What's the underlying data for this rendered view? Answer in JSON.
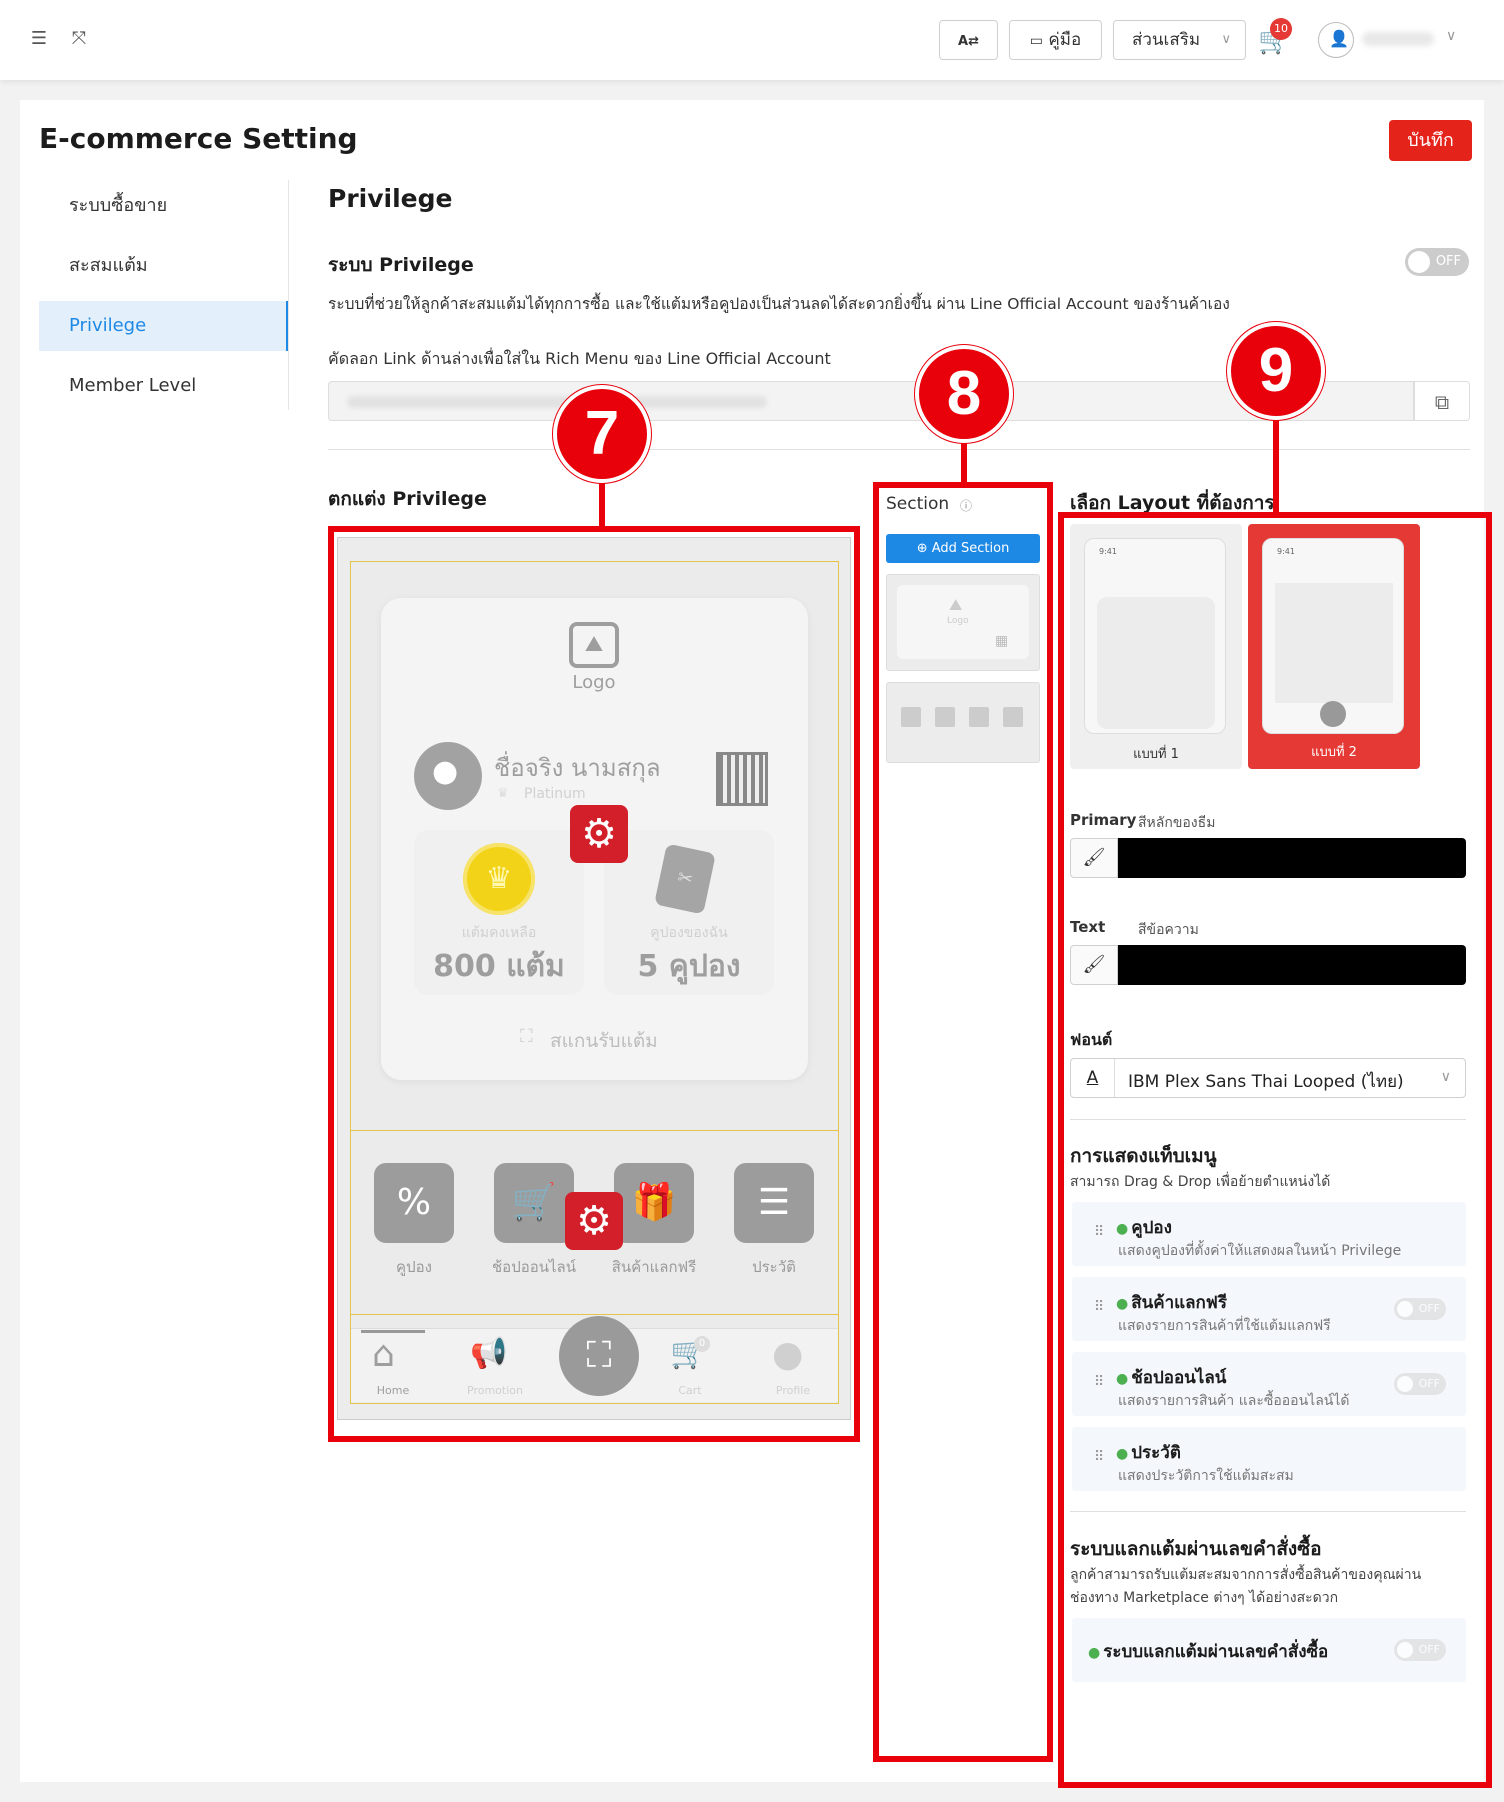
{
  "topbar": {
    "menu_icon": "menu-fold-icon",
    "expand_icon": "fullscreen-icon",
    "lang_icon": "language-icon",
    "manual_label": "คู่มือ",
    "addons_label": "ส่วนเสริม",
    "cart_count": "10"
  },
  "page": {
    "title": "E-commerce Setting",
    "save_label": "บันทึก"
  },
  "sidebar": {
    "items": [
      {
        "label": "ระบบซื้อขาย"
      },
      {
        "label": "สะสมแต้ม"
      },
      {
        "label": "Privilege"
      },
      {
        "label": "Member Level"
      }
    ]
  },
  "privilege": {
    "heading": "Privilege",
    "system_title": "ระบบ Privilege",
    "system_toggle": "OFF",
    "system_desc": "ระบบที่ช่วยให้ลูกค้าสะสมแต้มได้ทุกการซื้อ และใช้แต้มหรือคูปองเป็นส่วนลดได้สะดวกยิ่งขึ้น ผ่าน Line Official Account ของร้านค้าเอง",
    "link_label": "คัดลอก Link ด้านล่างเพื่อใส่ใน Rich Menu ของ Line Official Account",
    "customize_title": "ตกแต่ง Privilege"
  },
  "annotations": {
    "a7": "7",
    "a8": "8",
    "a9": "9"
  },
  "preview": {
    "logo": "Logo",
    "name": "ชื่อจริง นามสกุล",
    "tier": "Platinum",
    "points_label": "แต้มคงเหลือ",
    "points_value": "800 แต้ม",
    "coupons_label": "คูปองของฉัน",
    "coupons_value": "5 คูปอง",
    "scan_label": "สแกนรับแต้ม",
    "menu": [
      {
        "label": "คูปอง"
      },
      {
        "label": "ช้อปออนไลน์"
      },
      {
        "label": "สินค้าแลกฟรี"
      },
      {
        "label": "ประวัติ"
      }
    ],
    "tabs": [
      {
        "label": "Home"
      },
      {
        "label": "Promotion"
      },
      {
        "label": "Cart"
      },
      {
        "label": "Profile"
      }
    ],
    "cart_badge": "0"
  },
  "section_panel": {
    "title": "Section",
    "add_label": "⊕ Add Section",
    "thumb_logo": "Logo"
  },
  "layout_panel": {
    "title": "เลือก Layout ที่ต้องการ",
    "option1": "แบบที่ 1",
    "option2": "แบบที่ 2",
    "phone_time": "9:41",
    "primary_label": "Primary",
    "primary_desc": "สีหลักของธีม",
    "primary_color": "#000000",
    "text_label": "Text",
    "text_desc": "สีข้อความ",
    "text_color": "#000000",
    "font_label": "ฟอนต์",
    "font_value": "IBM Plex Sans Thai Looped (ไทย)",
    "tabmenu_title": "การแสดงแท็บเมนู",
    "tabmenu_desc": "สามารถ Drag & Drop เพื่อย้ายตำแหน่งได้",
    "tabs": [
      {
        "title": "คูปอง",
        "desc": "แสดงคูปองที่ตั้งค่าให้แสดงผลในหน้า Privilege",
        "toggle": ""
      },
      {
        "title": "สินค้าแลกฟรี",
        "desc": "แสดงรายการสินค้าที่ใช้แต้มแลกฟรี",
        "toggle": "OFF"
      },
      {
        "title": "ช้อปออนไลน์",
        "desc": "แสดงรายการสินค้า และซื้อออนไลน์ได้",
        "toggle": "OFF"
      },
      {
        "title": "ประวัติ",
        "desc": "แสดงประวัติการใช้แต้มสะสม",
        "toggle": ""
      }
    ],
    "redeem_title": "ระบบแลกแต้มผ่านเลขคำสั่งซื้อ",
    "redeem_desc1": "ลูกค้าสามารถรับแต้มสะสมจากการสั่งซื้อสินค้าของคุณผ่าน",
    "redeem_desc2": "ช่องทาง Marketplace ต่างๆ ได้อย่างสะดวก",
    "redeem_item": "ระบบแลกแต้มผ่านเลขคำสั่งซื้อ",
    "redeem_toggle": "OFF"
  }
}
